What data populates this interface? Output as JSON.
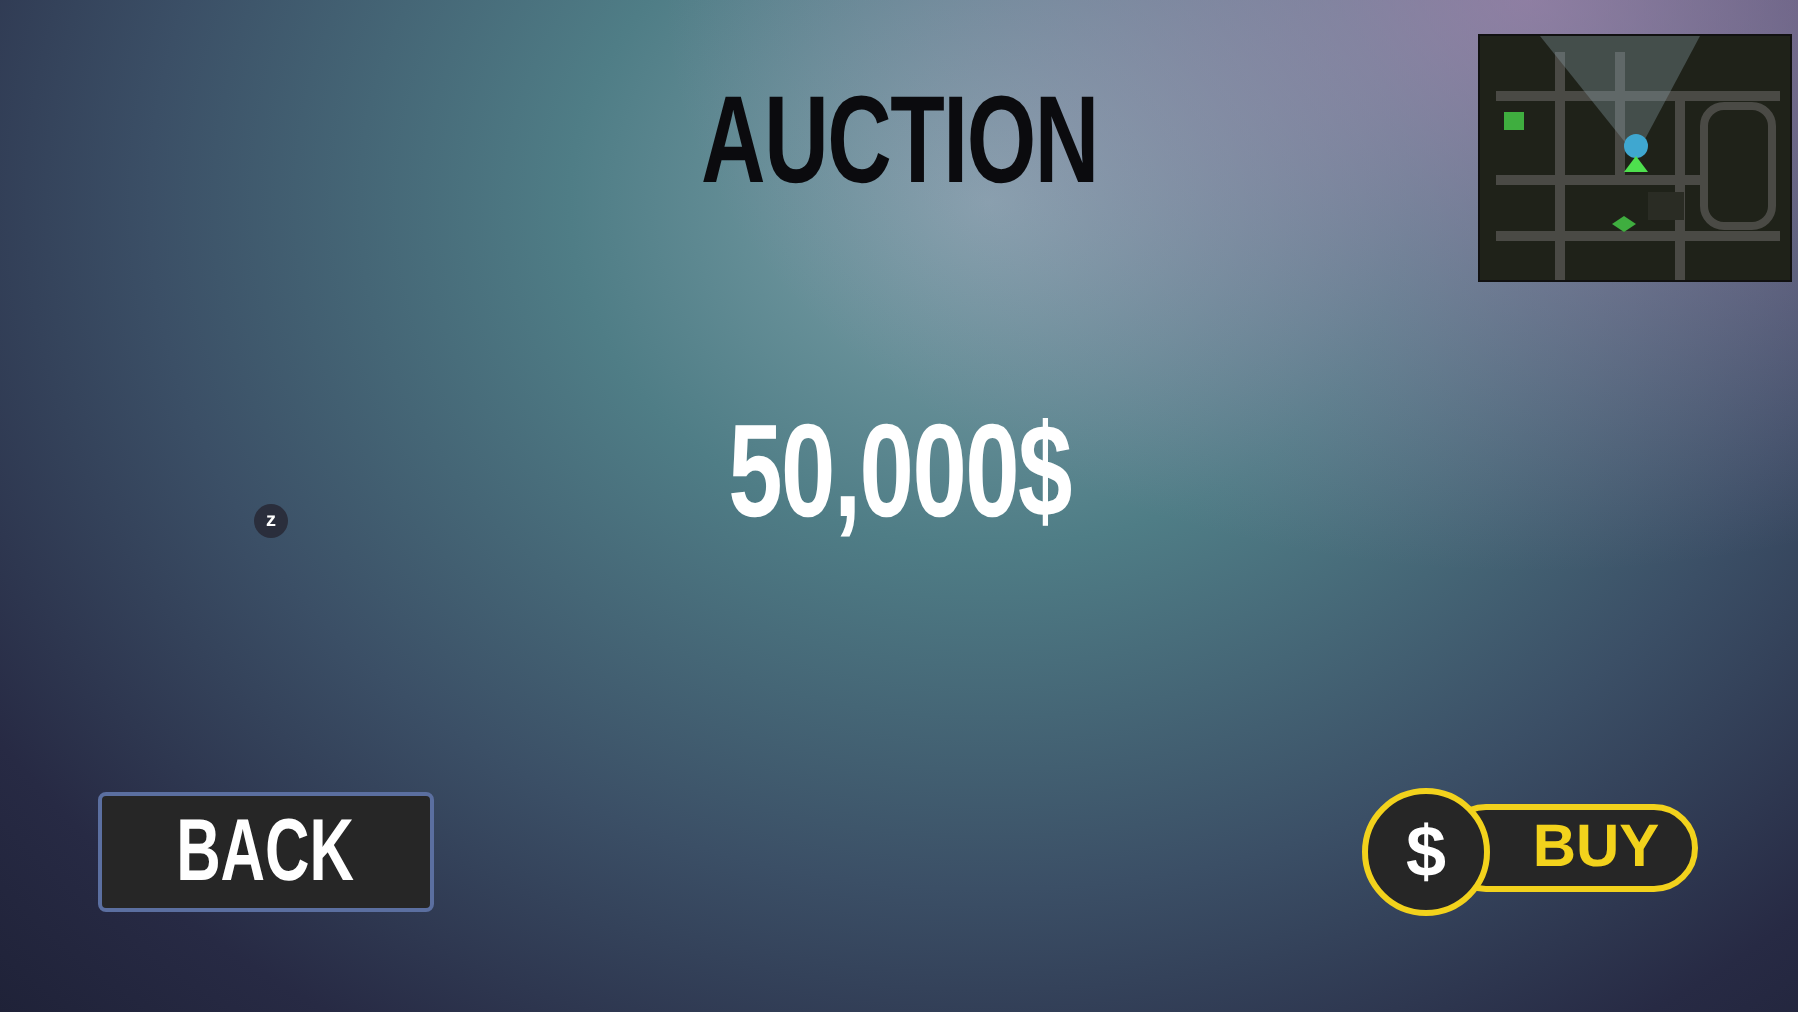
{
  "title": "AUCTION",
  "price": "50,000$",
  "key_hint": "z",
  "buttons": {
    "back": {
      "label": "BACK"
    },
    "buy": {
      "icon": "$",
      "label": "BUY"
    }
  }
}
